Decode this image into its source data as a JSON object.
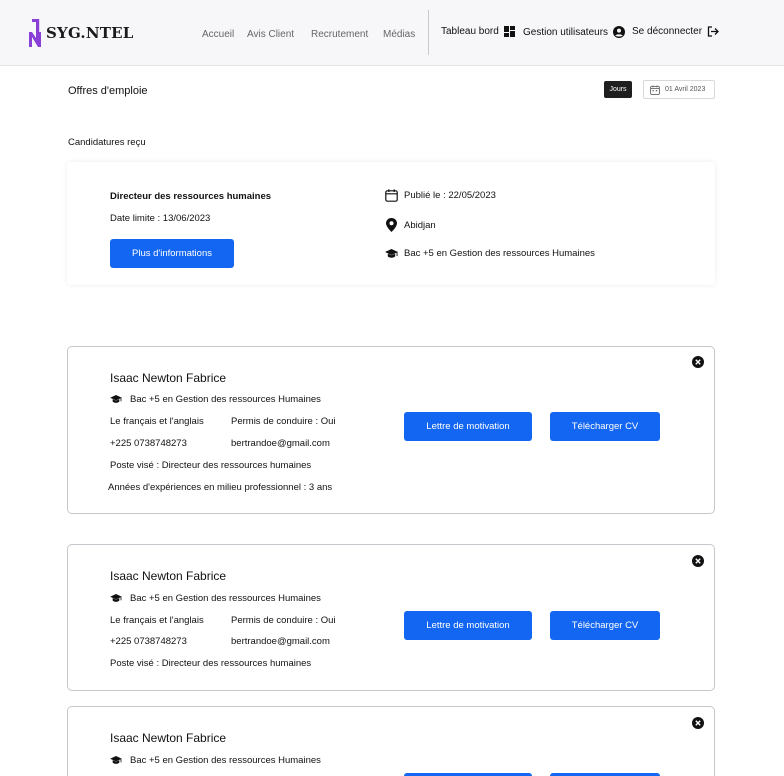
{
  "brand": {
    "name": "SYG.NTEL",
    "accent": "#8a3fd6"
  },
  "nav": {
    "links": [
      "Accueil",
      "Avis Client",
      "Recrutement",
      "Médias"
    ],
    "dashboard": "Tableau bord",
    "users": "Gestion utilisateurs",
    "logout": "Se déconnecter"
  },
  "page": {
    "title": "Offres d'emploie",
    "period_button": "Jours",
    "date": "01 Avril 2023",
    "section_title": "Candidatures reçu"
  },
  "job": {
    "title": "Directeur des ressources humaines",
    "deadline": "Date limite : 13/06/2023",
    "more_button": "Plus d'informations",
    "published": "Publié le : 22/05/2023",
    "location": "Abidjan",
    "education": "Bac +5 en Gestion des ressources Humaines"
  },
  "candidates": [
    {
      "name": "Isaac Newton Fabrice",
      "education": "Bac +5 en Gestion des ressources Humaines",
      "languages": "Le français et l'anglais",
      "license": "Permis de conduire : Oui",
      "phone": "+225 0738748273",
      "email": "bertrandoe@gmail.com",
      "position": "Poste visé : Directeur des ressources humaines",
      "experience": "Années d'expériences en milieu professionnel : 3 ans",
      "letter_button": "Lettre de motivation",
      "cv_button": "Télécharger CV"
    },
    {
      "name": "Isaac Newton Fabrice",
      "education": "Bac +5 en Gestion des ressources Humaines",
      "languages": "Le français et l'anglais",
      "license": "Permis de conduire : Oui",
      "phone": "+225 0738748273",
      "email": "bertrandoe@gmail.com",
      "position": "Poste visé : Directeur des ressources humaines",
      "letter_button": "Lettre de motivation",
      "cv_button": "Télécharger CV"
    },
    {
      "name": "Isaac Newton Fabrice",
      "education": "Bac +5 en Gestion des ressources Humaines"
    }
  ],
  "colors": {
    "primary_button": "#1366f2",
    "dark_chip": "#1f1f1f"
  },
  "icons": [
    "dashboard-icon",
    "user-circle-icon",
    "logout-icon",
    "calendar-icon",
    "location-pin-icon",
    "graduation-cap-icon",
    "close-circle-icon"
  ]
}
